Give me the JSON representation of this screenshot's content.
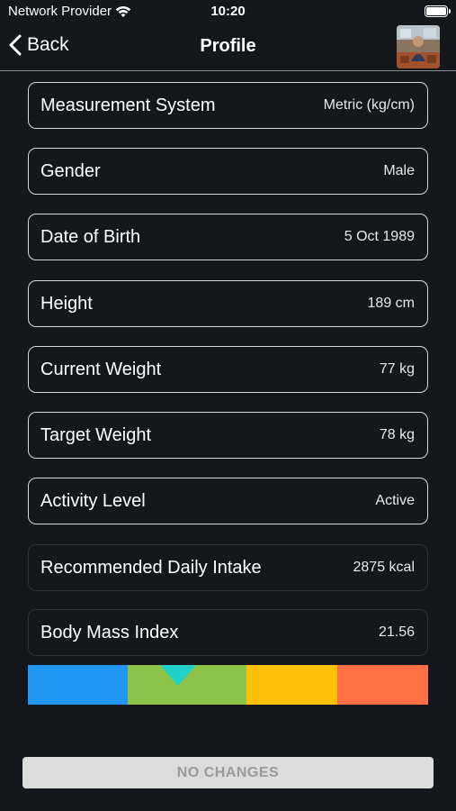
{
  "status_bar": {
    "carrier": "Network Provider",
    "time": "10:20",
    "battery_level": 1.0
  },
  "nav": {
    "back_label": "Back",
    "title": "Profile",
    "avatar_icon": "profile-photo"
  },
  "rows": [
    {
      "label": "Measurement System",
      "value": "Metric (kg/cm)",
      "editable": true
    },
    {
      "label": "Gender",
      "value": "Male",
      "editable": true
    },
    {
      "label": "Date of Birth",
      "value": "5 Oct 1989",
      "editable": true
    },
    {
      "label": "Height",
      "value": "189 cm",
      "editable": true
    },
    {
      "label": "Current Weight",
      "value": "77 kg",
      "editable": true
    },
    {
      "label": "Target Weight",
      "value": "78 kg",
      "editable": true
    },
    {
      "label": "Activity Level",
      "value": "Active",
      "editable": true
    },
    {
      "label": "Recommended Daily Intake",
      "value": "2875 kcal",
      "editable": false
    },
    {
      "label": "Body Mass Index",
      "value": "21.56",
      "editable": false
    }
  ],
  "bmi_scale": {
    "colors": [
      "#2196f3",
      "#8bc34a",
      "#ffc107",
      "#ff7043"
    ],
    "marker_color": "#1fd1c9",
    "bmi_value": 21.56
  },
  "footer": {
    "save_label": "NO CHANGES"
  }
}
